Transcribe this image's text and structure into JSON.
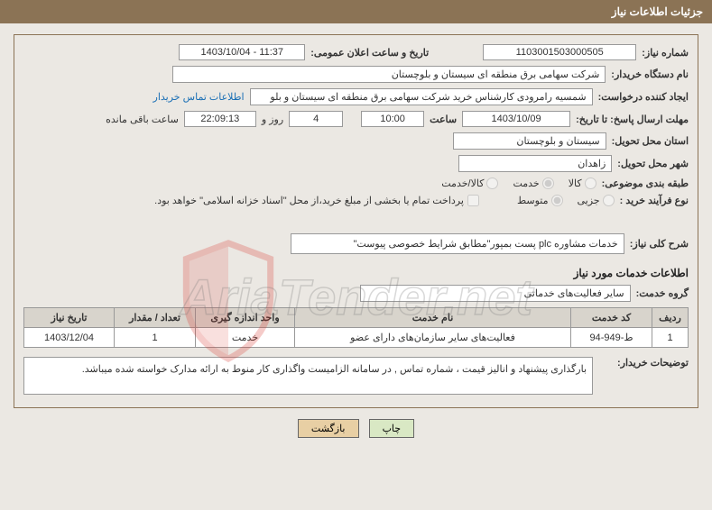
{
  "header": {
    "title": "جزئیات اطلاعات نیاز"
  },
  "fields": {
    "need_number_label": "شماره نیاز:",
    "need_number": "1103001503000505",
    "announce_datetime_label": "تاریخ و ساعت اعلان عمومی:",
    "announce_datetime": "1403/10/04 - 11:37",
    "buyer_org_label": "نام دستگاه خریدار:",
    "buyer_org": "شرکت سهامی برق منطقه ای سیستان و بلوچستان",
    "creator_label": "ایجاد کننده درخواست:",
    "creator": "شمسیه رامرودی کارشناس خرید شرکت سهامی برق منطقه ای سیستان و بلو",
    "contact_link": "اطلاعات تماس خریدار",
    "deadline_label": "مهلت ارسال پاسخ: تا تاریخ:",
    "deadline_date": "1403/10/09",
    "time_label": "ساعت",
    "deadline_time": "10:00",
    "days_remaining": "4",
    "days_text": "روز و",
    "time_remaining": "22:09:13",
    "remaining_text": "ساعت باقی مانده",
    "delivery_province_label": "استان محل تحویل:",
    "delivery_province": "سیستان و بلوچستان",
    "delivery_city_label": "شهر محل تحویل:",
    "delivery_city": "زاهدان",
    "category_label": "طبقه بندی موضوعی:",
    "category_options": {
      "kala": "کالا",
      "khedmat": "خدمت",
      "both": "کالا/خدمت"
    },
    "process_type_label": "نوع فرآیند خرید :",
    "process_options": {
      "partial": "جزیی",
      "medium": "متوسط"
    },
    "payment_note_label": "پرداخت تمام یا بخشی از مبلغ خرید،از محل \"اسناد خزانه اسلامی\" خواهد بود.",
    "need_summary_label": "شرح کلی نیاز:",
    "need_summary": "خدمات مشاوره plc پست بمپور\"مطابق شرایط خصوصی پیوست\"",
    "services_info_title": "اطلاعات خدمات مورد نیاز",
    "service_group_label": "گروه خدمت:",
    "service_group": "سایر فعالیت‌های خدماتی"
  },
  "table": {
    "headers": {
      "row": "ردیف",
      "code": "کد خدمت",
      "name": "نام خدمت",
      "unit": "واحد اندازه گیری",
      "qty": "تعداد / مقدار",
      "date": "تاریخ نیاز"
    },
    "rows": [
      {
        "row": "1",
        "code": "ط-949-94",
        "name": "فعالیت‌های سایر سازمان‌های دارای عضو",
        "unit": "خدمت",
        "qty": "1",
        "date": "1403/12/04"
      }
    ]
  },
  "explanation": {
    "label": "توضیحات خریدار:",
    "text": "بارگذاری پیشنهاد و انالیز قیمت ، شماره تماس , در سامانه الزامیست واگذاری کار منوط به ارائه مدارک خواسته شده میباشد."
  },
  "buttons": {
    "print": "چاپ",
    "back": "بازگشت"
  },
  "watermark": {
    "text": "AriaTender.net"
  }
}
